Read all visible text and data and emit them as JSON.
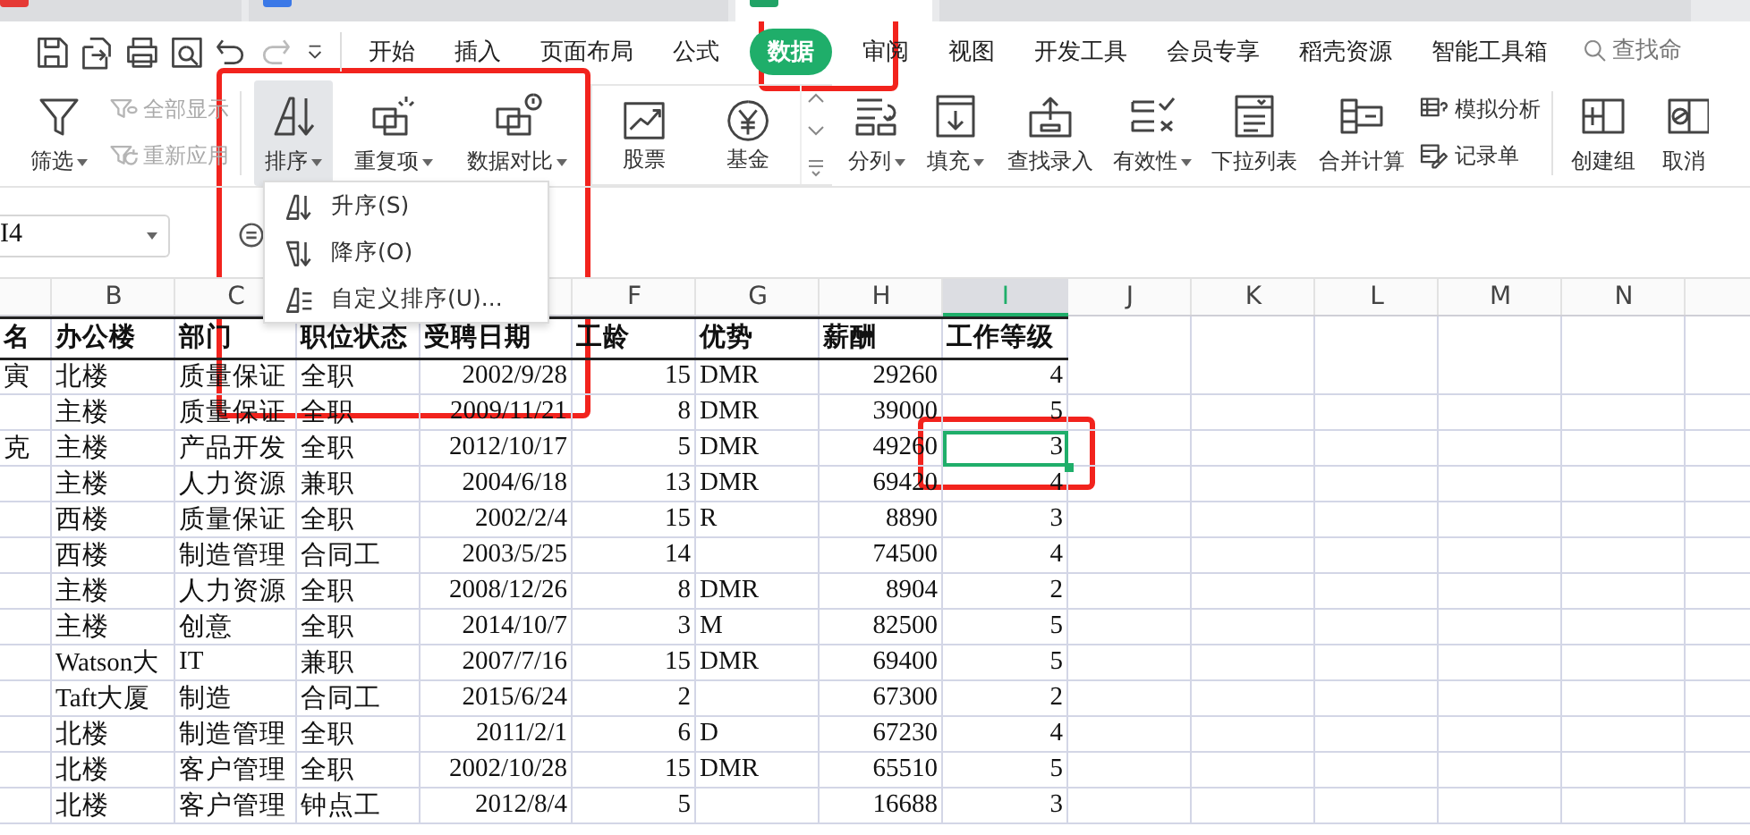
{
  "browser_tabs": [
    {
      "selected": false,
      "color": "#e53935"
    },
    {
      "selected": false,
      "color": "#3b78e7"
    },
    {
      "selected": true,
      "color": "#21a366"
    },
    {
      "selected": false
    }
  ],
  "quick_access": [
    {
      "kind": "save",
      "disabled": false
    },
    {
      "kind": "export",
      "disabled": false
    },
    {
      "kind": "print",
      "disabled": false
    },
    {
      "kind": "preview",
      "disabled": false
    },
    {
      "kind": "undo",
      "disabled": false
    },
    {
      "kind": "redo",
      "disabled": true
    },
    {
      "kind": "more",
      "disabled": false
    }
  ],
  "menu_tabs": [
    {
      "label": "开始",
      "selected": false
    },
    {
      "label": "插入",
      "selected": false
    },
    {
      "label": "页面布局",
      "selected": false
    },
    {
      "label": "公式",
      "selected": false
    },
    {
      "label": "数据",
      "selected": true
    },
    {
      "label": "审阅",
      "selected": false
    },
    {
      "label": "视图",
      "selected": false
    },
    {
      "label": "开发工具",
      "selected": false
    },
    {
      "label": "会员专享",
      "selected": false
    },
    {
      "label": "稻壳资源",
      "selected": false
    },
    {
      "label": "智能工具箱",
      "selected": false
    }
  ],
  "search": {
    "placeholder": "查找命"
  },
  "ribbon": [
    {
      "kind": "big",
      "label": "筛选",
      "dropdown": true,
      "pressed": false
    },
    {
      "kind": "stack",
      "entries": [
        {
          "label": "全部显示",
          "disabled": true
        },
        {
          "label": "重新应用",
          "disabled": true
        }
      ]
    },
    {
      "kind": "separator"
    },
    {
      "kind": "big",
      "label": "排序",
      "dropdown": true,
      "pressed": true
    },
    {
      "kind": "big",
      "label": "重复项",
      "dropdown": true,
      "pressed": false
    },
    {
      "kind": "big",
      "label": "数据对比",
      "dropdown": true,
      "pressed": false
    },
    {
      "kind": "gallery",
      "items": [
        {
          "label": "股票"
        },
        {
          "label": "基金"
        }
      ]
    },
    {
      "kind": "big",
      "label": "分列",
      "dropdown": true,
      "pressed": false
    },
    {
      "kind": "big",
      "label": "填充",
      "dropdown": true,
      "pressed": false
    },
    {
      "kind": "big",
      "label": "查找录入",
      "dropdown": false,
      "pressed": false
    },
    {
      "kind": "big",
      "label": "有效性",
      "dropdown": true,
      "pressed": false
    },
    {
      "kind": "big",
      "label": "下拉列表",
      "dropdown": false,
      "pressed": false
    },
    {
      "kind": "big",
      "label": "合并计算",
      "dropdown": false,
      "pressed": false
    },
    {
      "kind": "stack",
      "entries": [
        {
          "label": "模拟分析",
          "disabled": false
        },
        {
          "label": "记录单",
          "disabled": false
        }
      ]
    },
    {
      "kind": "separator"
    },
    {
      "kind": "big",
      "label": "创建组",
      "dropdown": false,
      "pressed": false
    },
    {
      "kind": "big",
      "label": "取消",
      "dropdown": false,
      "pressed": false
    }
  ],
  "name_box": {
    "value": "I4"
  },
  "sort_menu": [
    {
      "label": "升序(S)"
    },
    {
      "label": "降序(O)"
    },
    {
      "label": "自定义排序(U)..."
    }
  ],
  "sheet": {
    "columns": [
      {
        "kind": "blank"
      },
      {
        "kind": "letter",
        "label": "B",
        "selected": false
      },
      {
        "kind": "letter",
        "label": "C",
        "selected": false
      },
      {
        "kind": "blank"
      },
      {
        "kind": "blank"
      },
      {
        "kind": "letter",
        "label": "F",
        "selected": false
      },
      {
        "kind": "letter",
        "label": "G",
        "selected": false
      },
      {
        "kind": "letter",
        "label": "H",
        "selected": false
      },
      {
        "kind": "letter",
        "label": "I",
        "selected": true
      },
      {
        "kind": "letter",
        "label": "J",
        "selected": false
      },
      {
        "kind": "letter",
        "label": "K",
        "selected": false
      },
      {
        "kind": "letter",
        "label": "L",
        "selected": false
      },
      {
        "kind": "letter",
        "label": "M",
        "selected": false
      },
      {
        "kind": "letter",
        "label": "N",
        "selected": false
      },
      {
        "kind": "blank"
      }
    ],
    "rows": [
      {
        "kind": "header",
        "cells": [
          "名",
          "办公楼",
          "部门",
          "职位状态",
          "受聘日期",
          "工龄",
          "优势",
          "薪酬",
          "工作等级"
        ]
      },
      {
        "kind": "data",
        "selected": false,
        "cells": [
          "寅",
          "北楼",
          "质量保证",
          "全职",
          "2002/9/28",
          "15",
          "DMR",
          "29260",
          "4"
        ]
      },
      {
        "kind": "data",
        "selected": false,
        "cells": [
          null,
          "主楼",
          "质量保证",
          "全职",
          "2009/11/21",
          "8",
          "DMR",
          "39000",
          "5"
        ]
      },
      {
        "kind": "data",
        "selected": true,
        "cells": [
          "克",
          "主楼",
          "产品开发",
          "全职",
          "2012/10/17",
          "5",
          "DMR",
          "49260",
          "3"
        ]
      },
      {
        "kind": "data",
        "selected": false,
        "cells": [
          null,
          "主楼",
          "人力资源",
          "兼职",
          "2004/6/18",
          "13",
          "DMR",
          "69420",
          "4"
        ]
      },
      {
        "kind": "data",
        "selected": false,
        "cells": [
          null,
          "西楼",
          "质量保证",
          "全职",
          "2002/2/4",
          "15",
          "R",
          "8890",
          "3"
        ]
      },
      {
        "kind": "data",
        "selected": false,
        "cells": [
          null,
          "西楼",
          "制造管理",
          "合同工",
          "2003/5/25",
          "14",
          null,
          "74500",
          "4"
        ]
      },
      {
        "kind": "data",
        "selected": false,
        "cells": [
          null,
          "主楼",
          "人力资源",
          "全职",
          "2008/12/26",
          "8",
          "DMR",
          "8904",
          "2"
        ]
      },
      {
        "kind": "data",
        "selected": false,
        "cells": [
          null,
          "主楼",
          "创意",
          "全职",
          "2014/10/7",
          "3",
          "M",
          "82500",
          "5"
        ]
      },
      {
        "kind": "data",
        "selected": false,
        "cells": [
          null,
          "Watson大",
          "IT",
          "兼职",
          "2007/7/16",
          "15",
          "DMR",
          "69400",
          "5"
        ]
      },
      {
        "kind": "data",
        "selected": false,
        "cells": [
          null,
          "Taft大厦",
          "制造",
          "合同工",
          "2015/6/24",
          "2",
          null,
          "67300",
          "2"
        ]
      },
      {
        "kind": "data",
        "selected": false,
        "cells": [
          null,
          "北楼",
          "制造管理",
          "全职",
          "2011/2/1",
          "6",
          "D",
          "67230",
          "4"
        ]
      },
      {
        "kind": "data",
        "selected": false,
        "cells": [
          null,
          "北楼",
          "客户管理",
          "全职",
          "2002/10/28",
          "15",
          "DMR",
          "65510",
          "5"
        ]
      },
      {
        "kind": "data",
        "selected": false,
        "cells": [
          null,
          "北楼",
          "客户管理",
          "钟点工",
          "2012/8/4",
          "5",
          null,
          "16688",
          "3"
        ]
      }
    ]
  },
  "annotation_frames": [
    {
      "kind": "red_frame"
    },
    {
      "kind": "red_frame"
    },
    {
      "kind": "red_frame"
    }
  ]
}
